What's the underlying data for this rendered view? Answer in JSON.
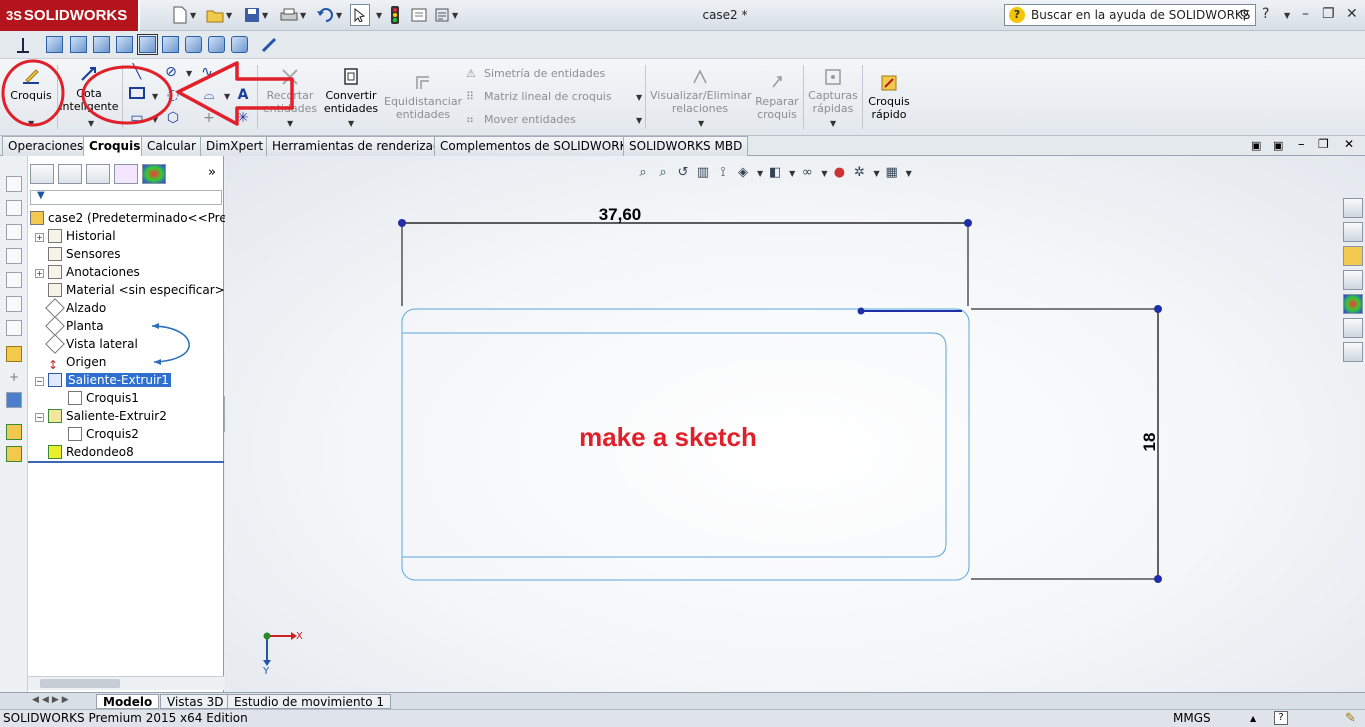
{
  "app": {
    "logo_prefix": "3S",
    "logo": "SOLIDWORKS",
    "doc_title": "case2 *"
  },
  "help_search": {
    "placeholder": "Buscar en la ayuda de SOLIDWORKS"
  },
  "ribbon": {
    "croquis": "Croquis",
    "cota_l1": "Cota",
    "cota_l2": "inteligente",
    "recortar_l1": "Recortar",
    "recortar_l2": "entidades",
    "convertir_l1": "Convertir",
    "convertir_l2": "entidades",
    "equidistanciar_l1": "Equidistanciar",
    "equidistanciar_l2": "entidades",
    "simetria": "Simetría de entidades",
    "matriz": "Matriz lineal de croquis",
    "mover": "Mover entidades",
    "visualizar_l1": "Visualizar/Eliminar",
    "visualizar_l2": "relaciones",
    "reparar_l1": "Reparar",
    "reparar_l2": "croquis",
    "capturas_l1": "Capturas",
    "capturas_l2": "rápidas",
    "rapido_l1": "Croquis",
    "rapido_l2": "rápido"
  },
  "tabs": [
    "Operaciones",
    "Croquis",
    "Calcular",
    "DimXpert",
    "Herramientas de renderizado",
    "Complementos de SOLIDWORKS",
    "SOLIDWORKS MBD"
  ],
  "tree": {
    "root": "case2  (Predeterminado<<Predet",
    "items": [
      "Historial",
      "Sensores",
      "Anotaciones",
      "Material <sin especificar>",
      "Alzado",
      "Planta",
      "Vista lateral",
      "Origen",
      "Saliente-Extruir1",
      "Croquis1",
      "Saliente-Extruir2",
      "Croquis2",
      "Redondeo8"
    ]
  },
  "sketch": {
    "dim_horizontal": "37,60",
    "dim_vertical": "18",
    "annotation": "make a sketch"
  },
  "axes": {
    "x": "X",
    "y": "Y"
  },
  "bottom_tabs": [
    "Modelo",
    "Vistas 3D",
    "Estudio de movimiento 1"
  ],
  "status": {
    "edition": "SOLIDWORKS Premium 2015 x64 Edition",
    "units": "MMGS"
  },
  "colors": {
    "brand": "#b4141c",
    "annotation": "#e0202a",
    "selection": "#2f6fd0",
    "sketch_edge": "#5aa6df"
  }
}
